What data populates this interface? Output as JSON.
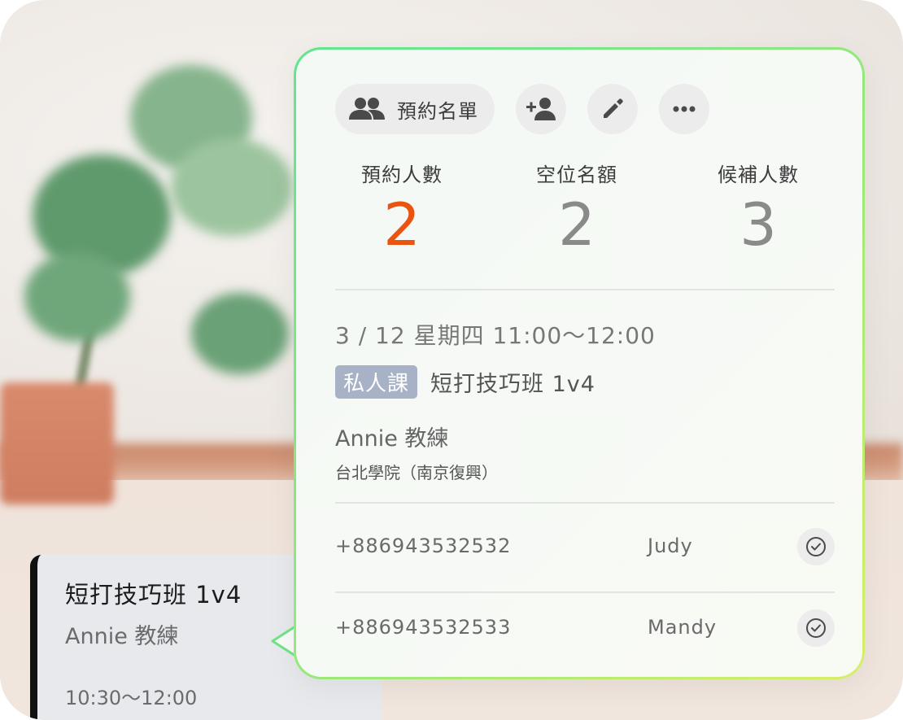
{
  "toolbar": {
    "booking_list_label": "預約名單",
    "booking_list_icon": "people-icon",
    "add_person_icon": "add-person-icon",
    "edit_icon": "pencil-icon",
    "more_icon": "more-icon"
  },
  "stats": {
    "booked": {
      "label": "預約人數",
      "value": "2",
      "color": "#ea5410"
    },
    "available": {
      "label": "空位名額",
      "value": "2",
      "color": "#8a8a8a"
    },
    "waitlist": {
      "label": "候補人數",
      "value": "3",
      "color": "#8a8a8a"
    }
  },
  "session": {
    "date_time": "3 / 12  星期四  11:00～12:00",
    "tag": "私人課",
    "class_name": "短打技巧班  1v4",
    "coach": "Annie 教練",
    "location": "台北學院（南京復興）"
  },
  "attendees": [
    {
      "phone": "+886943532532",
      "name": "Judy"
    },
    {
      "phone": "+886943532533",
      "name": "Mandy"
    }
  ],
  "event_card": {
    "title": "短打技巧班  1v4",
    "coach": "Annie 教練",
    "time": "10:30～12:00"
  }
}
